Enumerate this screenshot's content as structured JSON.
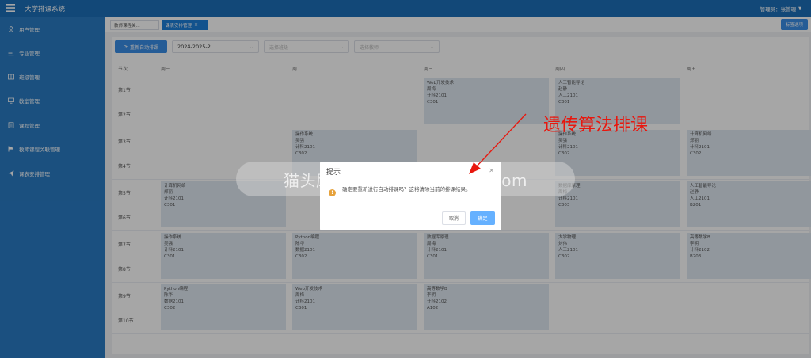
{
  "app": {
    "title": "大学排课系统",
    "user": "管理员：张管理"
  },
  "sidebar": {
    "items": [
      {
        "label": "用户管理",
        "icon": "user-icon"
      },
      {
        "label": "专业管理",
        "icon": "list-icon"
      },
      {
        "label": "班级管理",
        "icon": "table-icon"
      },
      {
        "label": "教室管理",
        "icon": "monitor-icon"
      },
      {
        "label": "课程管理",
        "icon": "course-icon"
      },
      {
        "label": "教师课程关联管理",
        "icon": "flag-icon"
      },
      {
        "label": "课表安排管理",
        "icon": "send-icon"
      }
    ]
  },
  "tabs": [
    {
      "label": "教师课程关..."
    },
    {
      "label": "课表安排管理"
    }
  ],
  "tab_action_label": "标签选项",
  "toolbar": {
    "auto_schedule_label": "重新自动排课",
    "semester": "2024-2025-2",
    "class_placeholder": "选择班级",
    "teacher_placeholder": "选择教师"
  },
  "timetable": {
    "headers": [
      "节次",
      "周一",
      "周二",
      "周三",
      "周四",
      "周五"
    ],
    "periods": [
      "第1节",
      "第2节",
      "第3节",
      "第4节",
      "第5节",
      "第6节",
      "第7节",
      "第8节",
      "第9节",
      "第10节"
    ],
    "slots": [
      {
        "day": 2,
        "block": 0,
        "lines": [
          "Web开发技术",
          "周梅",
          "计科2101",
          "C301"
        ]
      },
      {
        "day": 3,
        "block": 0,
        "lines": [
          "人工智能导论",
          "赵静",
          "人工2101",
          "C301"
        ]
      },
      {
        "day": 1,
        "block": 1,
        "lines": [
          "操作系统",
          "吴强",
          "计科2101",
          "C302"
        ]
      },
      {
        "day": 3,
        "block": 1,
        "lines": [
          "操作系统",
          "吴强",
          "计科2101",
          "C302"
        ]
      },
      {
        "day": 4,
        "block": 1,
        "lines": [
          "计算机网络",
          "郑丽",
          "计科2101",
          "C302"
        ]
      },
      {
        "day": 0,
        "block": 2,
        "lines": [
          "计算机网络",
          "郑丽",
          "计科2101",
          "C301"
        ]
      },
      {
        "day": 3,
        "block": 2,
        "lines": [
          "数据库原理",
          "周梅",
          "计科2101",
          "C303"
        ]
      },
      {
        "day": 4,
        "block": 2,
        "lines": [
          "人工智能导论",
          "赵静",
          "人工2101",
          "B201"
        ]
      },
      {
        "day": 0,
        "block": 3,
        "lines": [
          "操作系统",
          "吴强",
          "计科2101",
          "C301"
        ]
      },
      {
        "day": 1,
        "block": 3,
        "lines": [
          "Python编程",
          "陈华",
          "数据2101",
          "C302"
        ]
      },
      {
        "day": 2,
        "block": 3,
        "lines": [
          "数据库原理",
          "周梅",
          "计科2101",
          "C301"
        ]
      },
      {
        "day": 3,
        "block": 3,
        "lines": [
          "大学物理",
          "刘伟",
          "人工2101",
          "C302"
        ]
      },
      {
        "day": 4,
        "block": 3,
        "lines": [
          "高等数学B",
          "李明",
          "计科2102",
          "B203"
        ]
      },
      {
        "day": 0,
        "block": 4,
        "lines": [
          "Python编程",
          "陈华",
          "数据2101",
          "C302"
        ]
      },
      {
        "day": 1,
        "block": 4,
        "lines": [
          "Web开发技术",
          "周梅",
          "计科2101",
          "C301"
        ]
      },
      {
        "day": 2,
        "block": 4,
        "lines": [
          "高等数学B",
          "李明",
          "计科2102",
          "A102"
        ]
      }
    ]
  },
  "dialog": {
    "title": "提示",
    "message": "确定要重新进行自动排课吗？这将清除当前的排课结果。",
    "cancel_label": "取消",
    "ok_label": "确定",
    "close_icon": "close-icon",
    "warning_icon": "warning-icon"
  },
  "watermark": "猫头鹰源码 maotouyingcc.com",
  "annotation": "遗传算法排课",
  "colors": {
    "topbar": "#1d6fb8",
    "sidebar": "#2a7bc4",
    "primary": "#3a8ee6",
    "annotation": "#e8170e",
    "warning": "#e6a23c"
  }
}
